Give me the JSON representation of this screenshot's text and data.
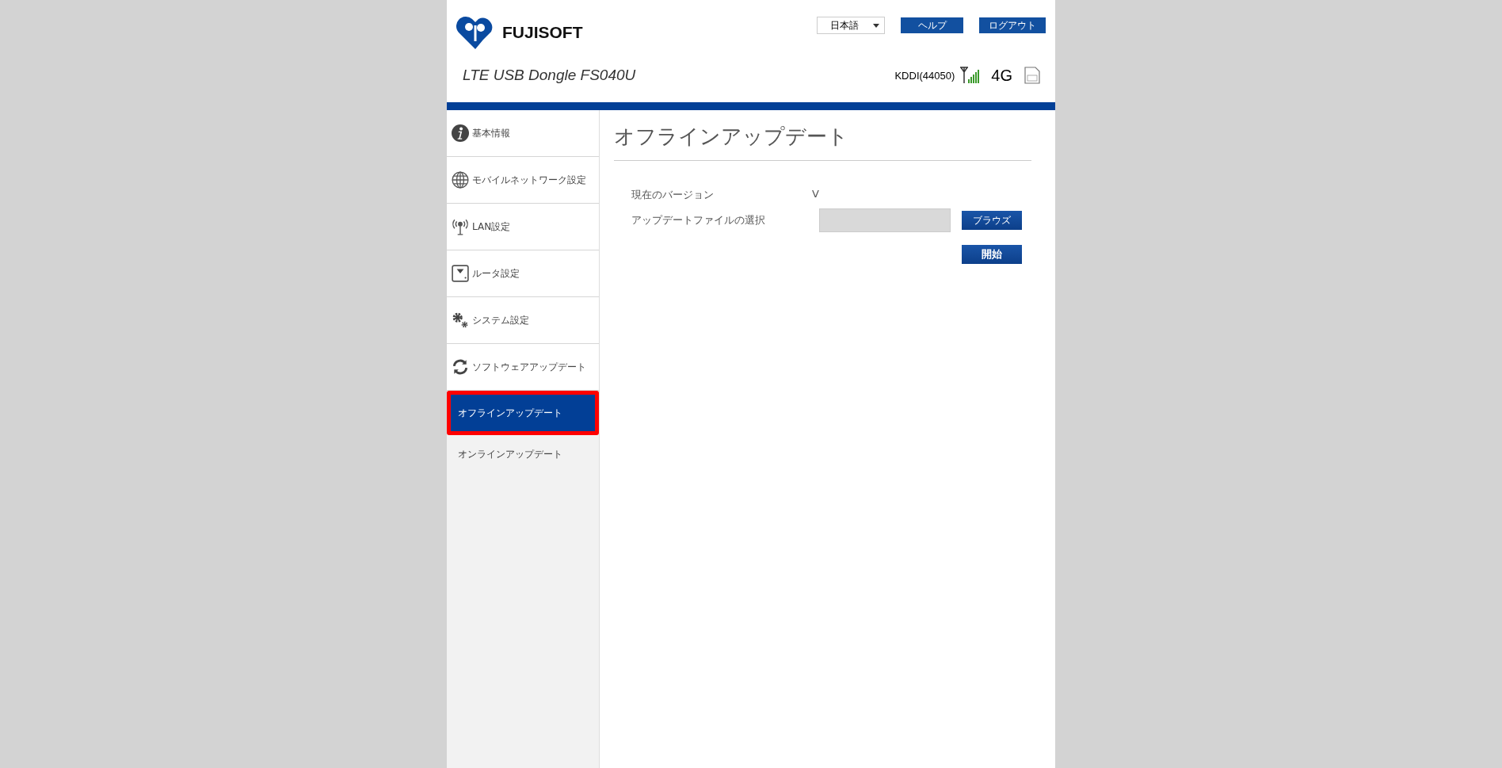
{
  "header": {
    "brand": "FUJISOFT",
    "language": "日本語",
    "buttons": [
      "ヘルプ",
      "ログアウト"
    ],
    "product": "LTE USB Dongle FS040U",
    "carrier": "KDDI(44050)",
    "network": "4G"
  },
  "sidebar": {
    "items": [
      {
        "label": "基本情報"
      },
      {
        "label": "モバイルネットワーク設定"
      },
      {
        "label": "LAN設定"
      },
      {
        "label": "ルータ設定"
      },
      {
        "label": "システム設定"
      },
      {
        "label": "ソフトウェアアップデート",
        "children": [
          {
            "label": "オフラインアップデート",
            "selected": true,
            "highlighted": true
          },
          {
            "label": "オンラインアップデート",
            "selected": false,
            "highlighted": false
          }
        ]
      }
    ]
  },
  "content": {
    "title": "オフラインアップデート",
    "version": {
      "label": "現在のバージョン",
      "value": "V"
    },
    "file": {
      "label": "アップデートファイルの選択",
      "button": "ブラウズ"
    },
    "start_button": "開始"
  }
}
